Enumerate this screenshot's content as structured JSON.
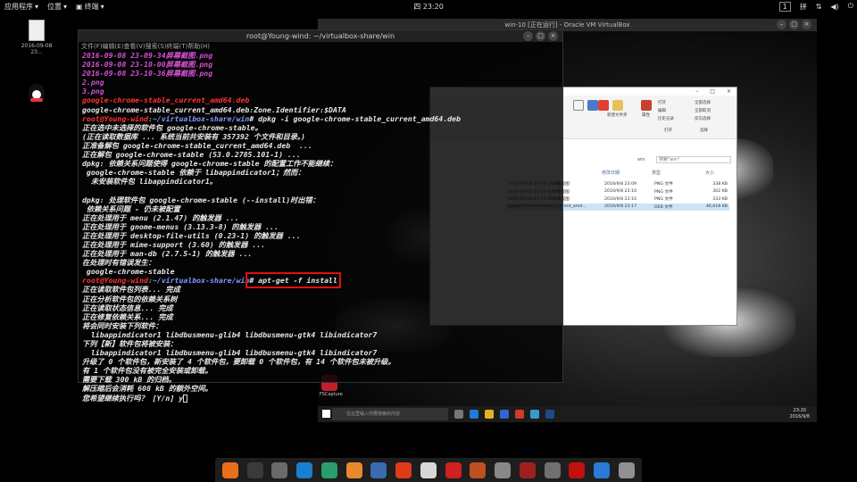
{
  "topbar": {
    "apps": "应用程序",
    "places": "位置",
    "terminal": "终端",
    "clock": "四 23:20",
    "workspace": "1",
    "input": "拼"
  },
  "desktop": {
    "file_label": "2016-09-08 23...",
    "app_label": "QQ"
  },
  "vm": {
    "title": "win-10 [正在运行] - Oracle VM VirtualBox",
    "search": "在这里输入你要搜索的内容",
    "time": "23:20",
    "date": "2016/9/8"
  },
  "explorer": {
    "ribbon": {
      "cut": "剪切",
      "copy_path": "复制路径",
      "paste_shortcut": "粘贴快捷方式",
      "move_to": "移动到",
      "copy_to": "复制到",
      "delete": "删除",
      "rename": "重命名",
      "new_folder": "新建文件夹",
      "properties": "属性",
      "open": "打开",
      "edit": "编辑",
      "history": "历史记录",
      "select_all": "全部选择",
      "select_none": "全部取消",
      "invert": "反向选择",
      "group_open": "打开",
      "group_select": "选择"
    },
    "address": "win",
    "search": "搜索\"win\"",
    "cols": {
      "date": "修改日期",
      "type": "类型",
      "size": "大小"
    },
    "files": [
      {
        "name": "2016-09-08 23-09-34屏幕截图",
        "date": "2016/9/8 23:09",
        "type": "PNG 文件",
        "size": "338 KB"
      },
      {
        "name": "2016-09-08 23-10-00屏幕截图",
        "date": "2016/9/8 23:10",
        "type": "PNG 文件",
        "size": "302 KB"
      },
      {
        "name": "2016-09-08 23-10-36屏幕截图",
        "date": "2016/9/8 23:10",
        "type": "PNG 文件",
        "size": "333 KB"
      },
      {
        "name": "google-chrome-stable_current_amd...",
        "date": "2016/9/8 23:17",
        "type": "DEB 文件",
        "size": "46,618 KB"
      }
    ]
  },
  "terminal": {
    "title": "root@Young-wind: ~/virtualbox-share/win",
    "menu": "文件(F)编辑(E)查看(V)搜索(S)终端(T)帮助(H)",
    "lines": [
      {
        "t": "2016-09-08 23-09-34屏幕截图.png",
        "c": "mag"
      },
      {
        "t": "2016-09-08 23-10-00屏幕截图.png",
        "c": "mag"
      },
      {
        "t": "2016-09-08 23-10-36屏幕截图.png",
        "c": "mag"
      },
      {
        "t": "2.png",
        "c": "mag"
      },
      {
        "t": "3.png",
        "c": "mag"
      },
      {
        "t": "google-chrome-stable_current_amd64.deb",
        "c": "red"
      },
      {
        "t": "google-chrome-stable_current_amd64.deb:Zone.Identifier:$DATA",
        "c": "wht"
      },
      {
        "p": "root@Young-wind",
        "d": ":~/virtualbox-share/win",
        "cmd": "# dpkg -i google-chrome-stable_current_amd64.deb"
      },
      {
        "t": "正在选中未选择的软件包 google-chrome-stable。",
        "c": "wht"
      },
      {
        "t": "(正在读取数据库 ... 系统当前共安装有 357392 个文件和目录。)",
        "c": "wht"
      },
      {
        "t": "正准备解包 google-chrome-stable_current_amd64.deb  ...",
        "c": "wht"
      },
      {
        "t": "正在解包 google-chrome-stable (53.0.2785.101-1) ...",
        "c": "wht"
      },
      {
        "t": "dpkg: 依赖关系问题使得 google-chrome-stable 的配置工作不能继续：",
        "c": "wht"
      },
      {
        "t": " google-chrome-stable 依赖于 libappindicator1；然而：",
        "c": "wht"
      },
      {
        "t": "  未安装软件包 libappindicator1。",
        "c": "wht"
      },
      {
        "t": "",
        "c": "wht"
      },
      {
        "t": "dpkg: 处理软件包 google-chrome-stable (--install)时出错：",
        "c": "wht"
      },
      {
        "t": " 依赖关系问题 - 仍未被配置",
        "c": "wht"
      },
      {
        "t": "正在处理用于 menu (2.1.47) 的触发器 ...",
        "c": "wht"
      },
      {
        "t": "正在处理用于 gnome-menus (3.13.3-8) 的触发器 ...",
        "c": "wht"
      },
      {
        "t": "正在处理用于 desktop-file-utils (0.23-1) 的触发器 ...",
        "c": "wht"
      },
      {
        "t": "正在处理用于 mime-support (3.60) 的触发器 ...",
        "c": "wht"
      },
      {
        "t": "正在处理用于 man-db (2.7.5-1) 的触发器 ...",
        "c": "wht"
      },
      {
        "t": "在处理时有错误发生：",
        "c": "wht"
      },
      {
        "t": " google-chrome-stable",
        "c": "wht"
      },
      {
        "p": "root@Young-wind",
        "d": ":~/virtualbox-share/win",
        "cmd": "# apt-get -f install",
        "hl": true
      },
      {
        "t": "正在读取软件包列表... 完成",
        "c": "wht"
      },
      {
        "t": "正在分析软件包的依赖关系树",
        "c": "wht"
      },
      {
        "t": "正在读取状态信息... 完成",
        "c": "wht"
      },
      {
        "t": "正在修复依赖关系... 完成",
        "c": "wht"
      },
      {
        "t": "将会同时安装下列软件：",
        "c": "wht"
      },
      {
        "t": "  libappindicator1 libdbusmenu-glib4 libdbusmenu-gtk4 libindicator7",
        "c": "wht"
      },
      {
        "t": "下列【新】软件包将被安装：",
        "c": "wht"
      },
      {
        "t": "  libappindicator1 libdbusmenu-glib4 libdbusmenu-gtk4 libindicator7",
        "c": "wht"
      },
      {
        "t": "升级了 0 个软件包，新安装了 4 个软件包，要卸载 0 个软件包，有 14 个软件包未被升级。",
        "c": "wht"
      },
      {
        "t": "有 1 个软件包没有被完全安装或卸载。",
        "c": "wht"
      },
      {
        "t": "需要下载 300 kB 的归档。",
        "c": "wht"
      },
      {
        "t": "解压缩后会消耗 608 kB 的额外空间。",
        "c": "wht"
      },
      {
        "t": "您希望继续执行吗？ [Y/n] y",
        "c": "wht",
        "cursor": true
      }
    ]
  },
  "dock": [
    {
      "name": "firefox-icon",
      "color": "#e8701a"
    },
    {
      "name": "terminal-icon",
      "color": "#3a3a3a"
    },
    {
      "name": "file-manager-icon",
      "color": "#6a6a6a"
    },
    {
      "name": "malwarebytes-icon",
      "color": "#1a7fd0"
    },
    {
      "name": "game-icon",
      "color": "#2a9d6a"
    },
    {
      "name": "sublime-text-icon",
      "color": "#e88a2a"
    },
    {
      "name": "tool-icon",
      "color": "#3a6ab0"
    },
    {
      "name": "foxit-icon",
      "color": "#e03a1a"
    },
    {
      "name": "clapper-icon",
      "color": "#d8d8d8"
    },
    {
      "name": "netease-music-icon",
      "color": "#d02020"
    },
    {
      "name": "media-icon",
      "color": "#c05020"
    },
    {
      "name": "screenshot-icon",
      "color": "#888888"
    },
    {
      "name": "wine-icon",
      "color": "#a02020"
    },
    {
      "name": "archive-icon",
      "color": "#707070"
    },
    {
      "name": "virus-icon",
      "color": "#c01010"
    },
    {
      "name": "vscode-icon",
      "color": "#2a7ad8"
    },
    {
      "name": "window-icon",
      "color": "#909090"
    }
  ]
}
